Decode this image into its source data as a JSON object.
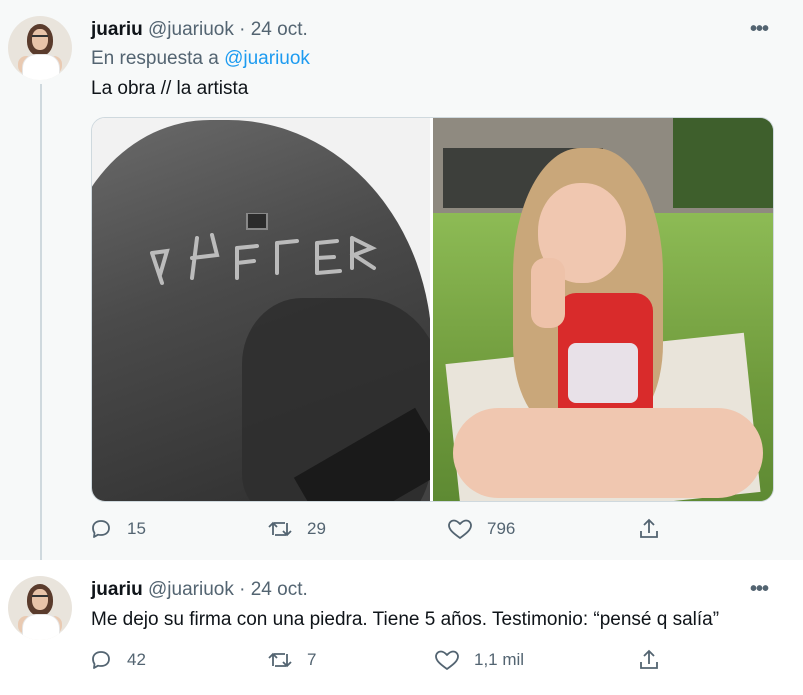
{
  "colors": {
    "link": "#1d9bf0",
    "muted": "#536471",
    "text": "#0f1419",
    "thread_line": "#cfd9de"
  },
  "tweets": [
    {
      "name": "juariu",
      "handle": "@juariuok",
      "separator": "·",
      "date": "24 oct.",
      "more_icon": "more-dots-icon",
      "reply_prefix": "En respuesta a",
      "reply_handle": "@juariuok",
      "text": "La obra // la artista",
      "media": [
        "car-hood-photo",
        "girl-on-lawn-photo"
      ],
      "actions": {
        "reply": {
          "icon": "reply-icon",
          "count": "15"
        },
        "retweet": {
          "icon": "retweet-icon",
          "count": "29"
        },
        "like": {
          "icon": "heart-icon",
          "count": "796"
        },
        "share": {
          "icon": "share-icon"
        }
      }
    },
    {
      "name": "juariu",
      "handle": "@juariuok",
      "separator": "·",
      "date": "24 oct.",
      "more_icon": "more-dots-icon",
      "text": "Me dejo su firma con una piedra. Tiene 5 años. Testimonio: “pensé q salía”",
      "actions": {
        "reply": {
          "icon": "reply-icon",
          "count": "42"
        },
        "retweet": {
          "icon": "retweet-icon",
          "count": "7"
        },
        "like": {
          "icon": "heart-icon",
          "count": "1,1 mil"
        },
        "share": {
          "icon": "share-icon"
        }
      }
    }
  ]
}
